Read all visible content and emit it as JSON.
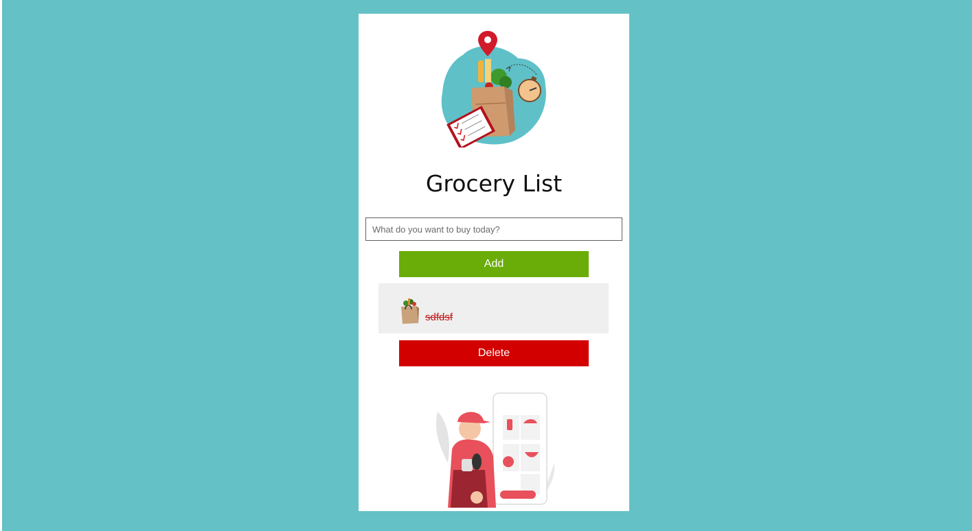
{
  "page": {
    "title": "Grocery List"
  },
  "form": {
    "search_placeholder": "What do you want to buy today?",
    "search_value": "",
    "add_label": "Add"
  },
  "list": {
    "items": [
      {
        "text": "sdfdsf",
        "completed": true,
        "icon": "grocery-bag-icon"
      }
    ]
  },
  "actions": {
    "delete_label": "Delete"
  },
  "images": {
    "hero": "grocery-bag-illustration",
    "footer": "delivery-person-illustration"
  },
  "colors": {
    "background": "#64c1c6",
    "card": "#ffffff",
    "add_button": "#6aad08",
    "delete_button": "#d30000",
    "list_background": "#efefef",
    "completed_text": "#c11616"
  }
}
